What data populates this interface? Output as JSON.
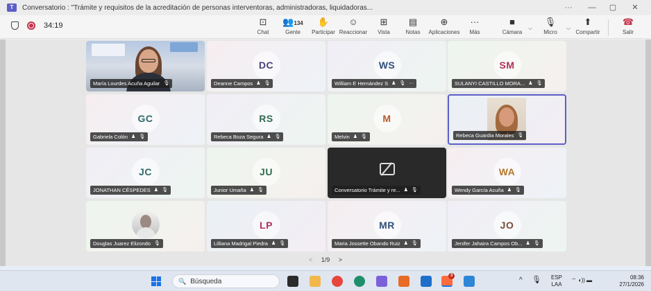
{
  "window": {
    "title": "Conversatorio : \"Trámite y requisitos de la acreditación de personas interventoras, administradoras, liquidadoras...",
    "more": "···",
    "minimize": "—",
    "maximize": "▢",
    "close": "✕"
  },
  "toolbar": {
    "timer": "34:19",
    "people_count": "134",
    "buttons": [
      {
        "label": "Chat",
        "icon": "chat-icon",
        "glyph": "⊡"
      },
      {
        "label": "Gente",
        "icon": "people-icon",
        "glyph": "👥"
      },
      {
        "label": "Participar",
        "icon": "raise-hand-icon",
        "glyph": "✋"
      },
      {
        "label": "Reaccionar",
        "icon": "emoji-icon",
        "glyph": "☺"
      },
      {
        "label": "Vista",
        "icon": "grid-view-icon",
        "glyph": "⊞"
      },
      {
        "label": "Notas",
        "icon": "notes-icon",
        "glyph": "▤"
      },
      {
        "label": "Aplicaciones",
        "icon": "apps-icon",
        "glyph": "⊕"
      },
      {
        "label": "Más",
        "icon": "more-icon",
        "glyph": "···"
      },
      {
        "label": "Cámara",
        "icon": "camera-icon",
        "glyph": "■"
      },
      {
        "label": "Micro",
        "icon": "mic-off-icon",
        "glyph": "🎙"
      },
      {
        "label": "Compartir",
        "icon": "share-icon",
        "glyph": "⬆"
      },
      {
        "label": "Salir",
        "icon": "leave-call-icon",
        "glyph": "☎"
      }
    ]
  },
  "participants": [
    {
      "name": "María Lourdes Acuña Aguilar",
      "initials": "",
      "kind": "video"
    },
    {
      "name": "Deanne Campos",
      "initials": "DC",
      "color": "#4a3f7a",
      "kind": "avatar",
      "hand": true
    },
    {
      "name": "William E Hernández S",
      "initials": "WS",
      "color": "#2f4f7a",
      "kind": "avatar",
      "hand": true,
      "more": true
    },
    {
      "name": "SULANYI CASTILLO MORA...",
      "initials": "SM",
      "color": "#b0305a",
      "kind": "avatar",
      "hand": true
    },
    {
      "name": "Gabriela Colón",
      "initials": "GC",
      "color": "#2f6a6a",
      "kind": "avatar",
      "hand": true
    },
    {
      "name": "Rebeca Boza Segura",
      "initials": "RS",
      "color": "#2f6a50",
      "kind": "avatar",
      "hand": true
    },
    {
      "name": "Melvin",
      "initials": "M",
      "color": "#b55a2a",
      "kind": "avatar",
      "hand": true
    },
    {
      "name": "Rebeca Guardia Morales",
      "initials": "",
      "kind": "video-small"
    },
    {
      "name": "JONATHAN CÉSPEDES",
      "initials": "JC",
      "color": "#2f6a6a",
      "kind": "avatar",
      "hand": true
    },
    {
      "name": "Junior Umaña",
      "initials": "JU",
      "color": "#2f6a50",
      "kind": "avatar",
      "hand": true
    },
    {
      "name": "Conversatorio Trámite y re...",
      "initials": "",
      "kind": "screen",
      "hand": true
    },
    {
      "name": "Wendy García Acuña",
      "initials": "WA",
      "color": "#b5772a",
      "kind": "avatar",
      "hand": true
    },
    {
      "name": "Douglas Juarez Elizondo",
      "initials": "",
      "kind": "photo"
    },
    {
      "name": "Lilliana Madrigal Piedra",
      "initials": "LP",
      "color": "#b0305a",
      "kind": "avatar",
      "hand": true
    },
    {
      "name": "Maria Jossette Obando Ruiz",
      "initials": "MR",
      "color": "#2f4f7a",
      "kind": "avatar",
      "hand": true
    },
    {
      "name": "Jenifer Jahaira Campos Ob...",
      "initials": "JO",
      "color": "#7a4a3a",
      "kind": "avatar",
      "hand": true
    }
  ],
  "pager": {
    "prev": "<",
    "label": "1/9",
    "next": ">"
  },
  "taskbar": {
    "search_placeholder": "Búsqueda",
    "notification_count": "3",
    "lang_top": "ESP",
    "lang_bottom": "LAA",
    "time": "08:36",
    "date": "27/1/2026",
    "tray_chevron": "^",
    "tray_icons": "⌔ ◖)) ▬"
  },
  "colors": {
    "accent": "#5b5fc7",
    "record": "#c4314b",
    "leave": "#c4314b"
  }
}
